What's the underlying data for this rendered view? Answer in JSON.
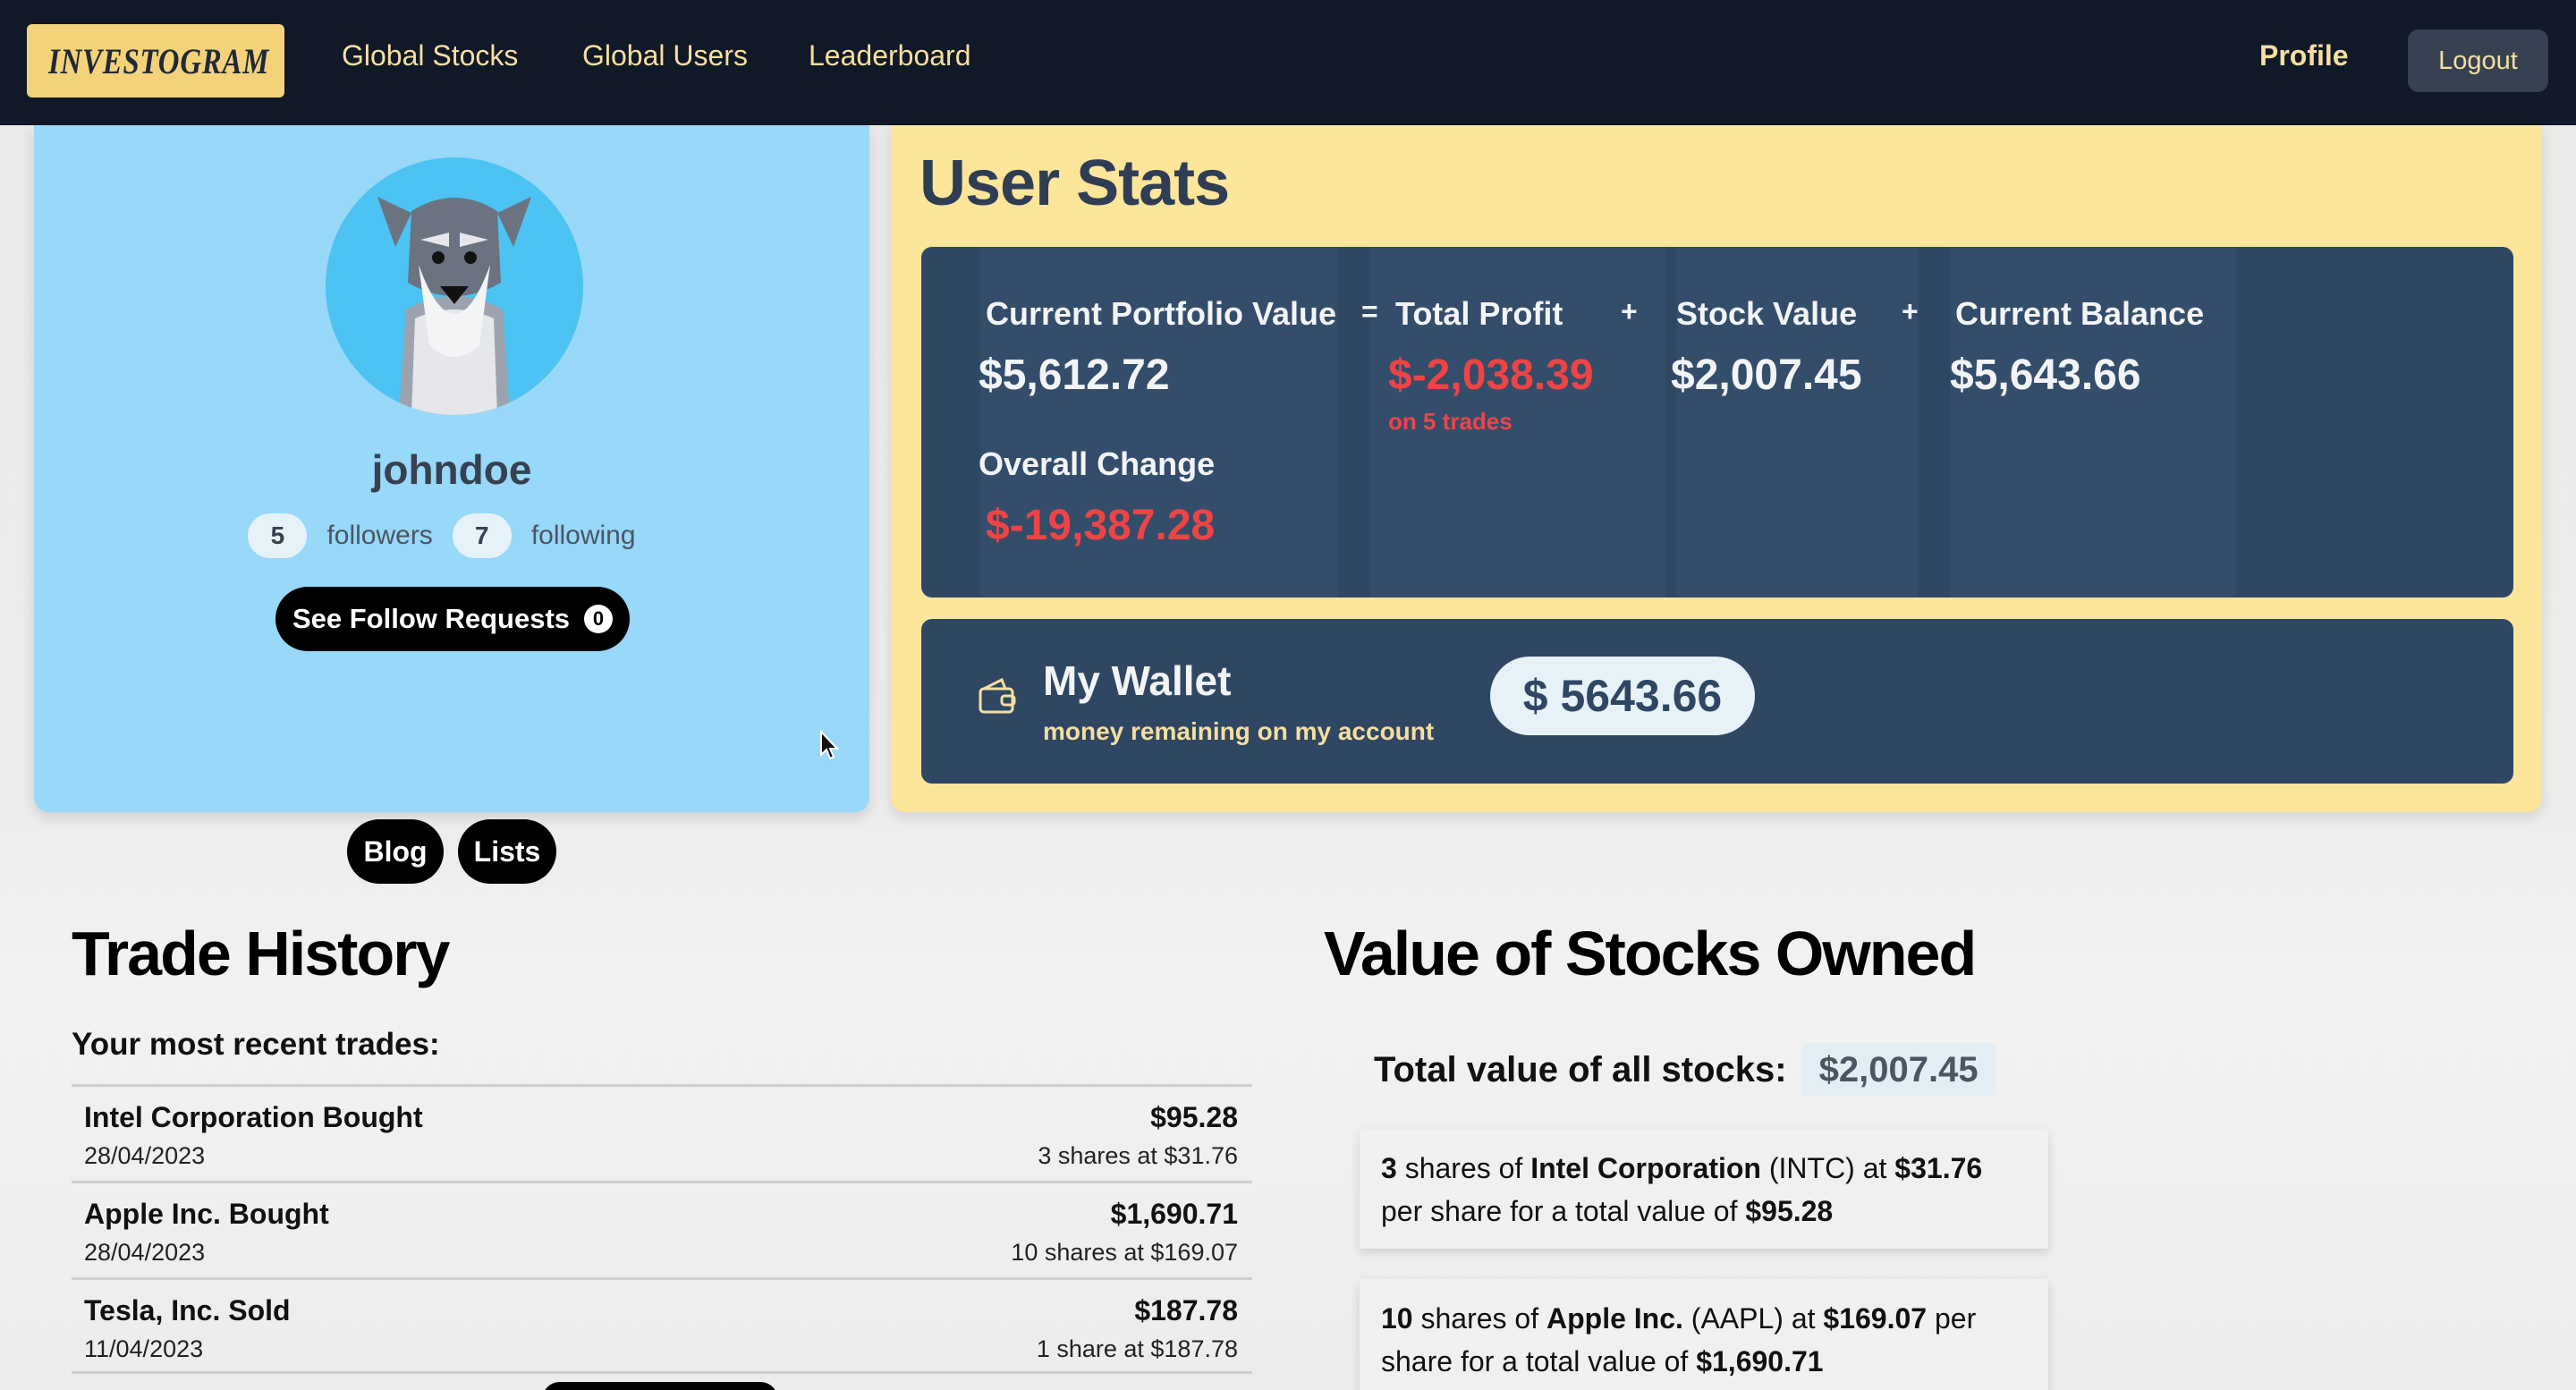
{
  "nav": {
    "logo_text": "INVESTOGRAM",
    "links": [
      "Global Stocks",
      "Global Users",
      "Leaderboard"
    ],
    "profile": "Profile",
    "logout": "Logout"
  },
  "profile": {
    "username": "johndoe",
    "followers_count": "5",
    "followers_label": "followers",
    "following_count": "7",
    "following_label": "following",
    "requests_label": "See Follow Requests",
    "requests_count": "0",
    "blog_label": "Blog",
    "lists_label": "Lists"
  },
  "stats": {
    "title": "User Stats",
    "portfolio_label": "Current Portfolio Value",
    "portfolio_value": "$5,612.72",
    "op_equals": "=",
    "profit_label": "Total Profit",
    "profit_value": "$-2,038.39",
    "profit_sub": "on 5 trades",
    "op_plus_1": "+",
    "stock_label": "Stock Value",
    "stock_value": "$2,007.45",
    "op_plus_2": "+",
    "balance_label": "Current Balance",
    "balance_value": "$5,643.66",
    "overall_label": "Overall Change",
    "overall_value": "$-19,387.28"
  },
  "wallet": {
    "title": "My Wallet",
    "subtitle": "money remaining on my account",
    "amount": "$ 5643.66"
  },
  "trades": {
    "title": "Trade History",
    "subtitle": "Your most recent trades:",
    "rows": [
      {
        "name": "Intel Corporation Bought",
        "date": "28/04/2023",
        "total": "$95.28",
        "detail": "3 shares at $31.76"
      },
      {
        "name": "Apple Inc. Bought",
        "date": "28/04/2023",
        "total": "$1,690.71",
        "detail": "10 shares at $169.07"
      },
      {
        "name": "Tesla, Inc. Sold",
        "date": "11/04/2023",
        "total": "$187.78",
        "detail": "1 share at $187.78"
      }
    ]
  },
  "owned": {
    "title": "Value of Stocks Owned",
    "total_label": "Total value of all stocks:",
    "total_value": "$2,007.45",
    "cards": [
      {
        "shares": "3",
        "shares_word": "shares of",
        "company": "Intel Corporation",
        "ticker": "(INTC)",
        "at": "at",
        "price": "$31.76",
        "per": "per share for a total value of",
        "value": "$95.28"
      },
      {
        "shares": "10",
        "shares_word": "shares of",
        "company": "Apple Inc.",
        "ticker": "(AAPL)",
        "at": "at",
        "price": "$169.07",
        "per": "per share for a total value of",
        "value": "$1,690.71"
      }
    ]
  },
  "colors": {
    "navbar": "#111827",
    "nav_text": "#f5dfa0",
    "profile_bg": "#98d8f8",
    "stats_bg": "#fde59a",
    "panel": "#2f4763",
    "negative": "#ef4444"
  }
}
